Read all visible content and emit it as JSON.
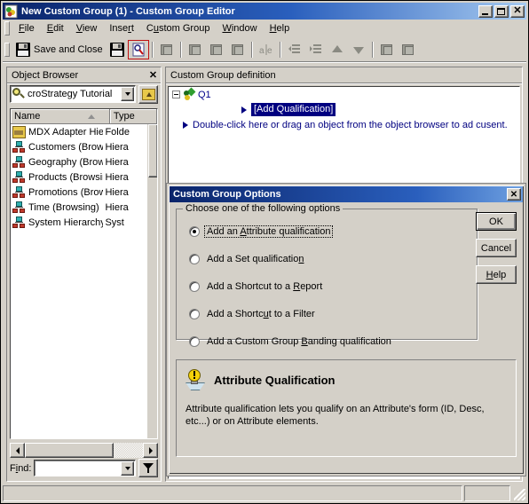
{
  "window": {
    "title": "New Custom Group (1) - Custom Group Editor",
    "icon": "custom-group-icon",
    "minimize_label": "",
    "maximize_label": "",
    "close_label": "✕"
  },
  "menu": {
    "items": [
      {
        "label": "File",
        "accel": "F"
      },
      {
        "label": "Edit",
        "accel": "E"
      },
      {
        "label": "View",
        "accel": "V"
      },
      {
        "label": "Insert",
        "accel": "r"
      },
      {
        "label": "Custom Group",
        "accel": "u"
      },
      {
        "label": "Window",
        "accel": "W"
      },
      {
        "label": "Help",
        "accel": "H"
      }
    ]
  },
  "toolbar": {
    "save_and_close_label": "Save and Close",
    "buttons": [
      {
        "name": "save-and-close-button",
        "icon": "floppy-icon"
      },
      {
        "name": "save-button",
        "icon": "floppy-new-icon"
      },
      {
        "name": "view-filter-button",
        "icon": "filter-view-icon"
      },
      {
        "name": "insert-object-button",
        "icon": "cube-icon"
      },
      {
        "name": "add-attribute-qualification-button",
        "icon": "cube-pointer-icon"
      },
      {
        "name": "add-set-qualification-button",
        "icon": "cube-stack-icon"
      },
      {
        "name": "add-banding-qualification-button",
        "icon": "cube-question-icon"
      },
      {
        "name": "toggle-expression-button",
        "icon": "a-e-icon"
      },
      {
        "name": "promote-button",
        "icon": "outdent-icon"
      },
      {
        "name": "demote-button",
        "icon": "indent-icon"
      },
      {
        "name": "move-up-button",
        "icon": "arrow-up-icon"
      },
      {
        "name": "move-down-button",
        "icon": "arrow-down-icon"
      },
      {
        "name": "expand-all-button",
        "icon": "cubes-expand-icon"
      },
      {
        "name": "collapse-all-button",
        "icon": "cubes-collapse-icon"
      }
    ]
  },
  "object_browser": {
    "title": "Object Browser",
    "close_label": "✕",
    "source_value": "croStrategy Tutorial",
    "source_icon": "magnifier-icon",
    "up_button_icon": "up-folder-icon",
    "columns": [
      {
        "label": "Name",
        "sort": "asc"
      },
      {
        "label": "Type"
      }
    ],
    "rows": [
      {
        "name": "MDX Adapter Hierarchies",
        "type": "Folde",
        "icon": "folder-icon"
      },
      {
        "name": "Customers (Browsing)",
        "type": "Hiera",
        "icon": "hierarchy-icon"
      },
      {
        "name": "Geography (Browsing)",
        "type": "Hiera",
        "icon": "hierarchy-icon"
      },
      {
        "name": "Products (Browsing)",
        "type": "Hiera",
        "icon": "hierarchy-icon"
      },
      {
        "name": "Promotions (Browsing)",
        "type": "Hiera",
        "icon": "hierarchy-icon"
      },
      {
        "name": "Time (Browsing)",
        "type": "Hiera",
        "icon": "hierarchy-icon"
      },
      {
        "name": "System Hierarchy",
        "type": "Syst",
        "icon": "hierarchy-icon"
      }
    ],
    "find_label": "Find:",
    "find_value": "",
    "find_placeholder": "",
    "filter_icon": "funnel-icon"
  },
  "definition_panel": {
    "title": "Custom Group definition",
    "node_label": "Q1",
    "node_icon": "custom-group-node-icon",
    "add_qualification_label": "[Add Qualification]",
    "hint_label": "Double-click here or drag an object from the object browser to ad cusent."
  },
  "dialog": {
    "title": "Custom Group Options",
    "close_label": "✕",
    "groupbox_legend": "Choose one of the following options",
    "options": [
      {
        "label_pre": "Add an ",
        "accel": "A",
        "label_post": "ttribute qualification",
        "checked": true,
        "focused": true
      },
      {
        "label_pre": "Add a Set qualificatio",
        "accel": "n",
        "label_post": "",
        "checked": false,
        "focused": false
      },
      {
        "label_pre": "Add a Shortcut to a ",
        "accel": "R",
        "label_post": "eport",
        "checked": false,
        "focused": false
      },
      {
        "label_pre": "Add a Shortc",
        "accel": "u",
        "label_post": "t to a Filter",
        "checked": false,
        "focused": false
      },
      {
        "label_pre": "Add a Custom Group ",
        "accel": "B",
        "label_post": "anding qualification",
        "checked": false,
        "focused": false
      }
    ],
    "buttons": [
      {
        "name": "ok-button",
        "label_pre": "OK",
        "accel": "",
        "label_post": "",
        "default": true
      },
      {
        "name": "cancel-button",
        "label_pre": "Cancel",
        "accel": "",
        "label_post": "",
        "default": false
      },
      {
        "name": "help-button",
        "label_pre": "",
        "accel": "H",
        "label_post": "elp",
        "default": false
      }
    ],
    "info": {
      "icon": "lightbulb-icon",
      "title": "Attribute Qualification",
      "body": "Attribute qualification lets you qualify on an Attribute's form (ID, Desc, etc...) or on Attribute elements."
    }
  },
  "statusbar": {
    "message": "",
    "secondary": ""
  },
  "colors": {
    "face": "#d4d0c8",
    "title_start": "#0a246a",
    "title_end": "#a6caf0",
    "selection": "#000080",
    "tree_text": "#00008b"
  }
}
